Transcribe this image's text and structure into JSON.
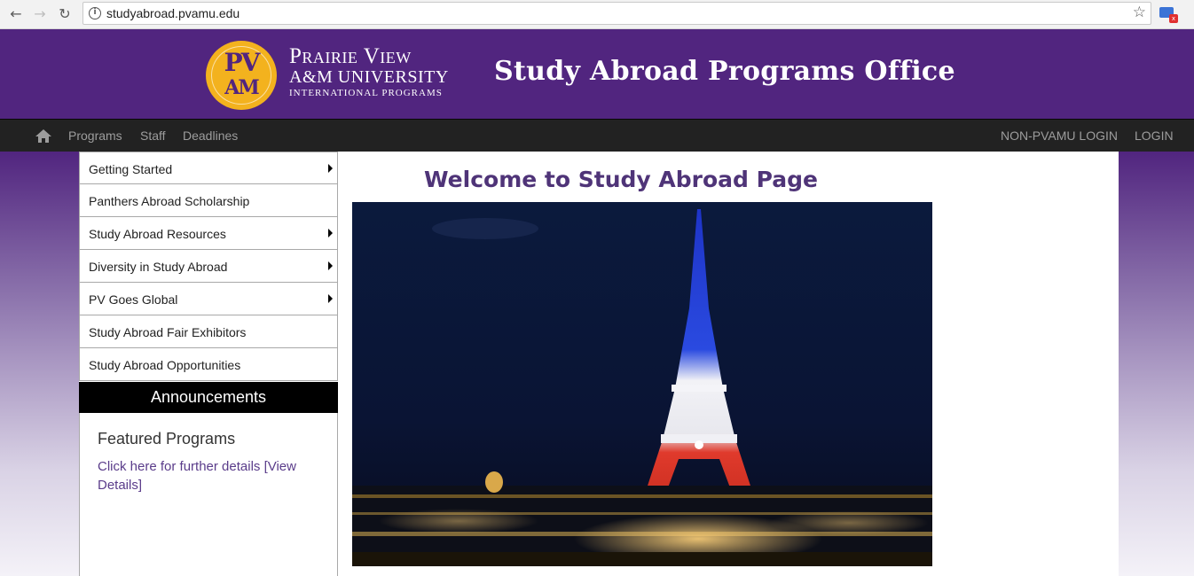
{
  "browser": {
    "url": "studyabroad.pvamu.edu",
    "back_icon": "arrow-left-icon",
    "forward_icon": "arrow-right-icon",
    "reload_icon": "reload-icon",
    "bookmark_icon": "star-icon",
    "extension_icon": "screen-extension-icon"
  },
  "header": {
    "logo_seal_top": "PV",
    "logo_seal_bottom": "AM",
    "logo_line1": "Prairie View",
    "logo_line2": "A&M UNIVERSITY",
    "logo_line3": "INTERNATIONAL PROGRAMS",
    "title": "Study Abroad Programs Office",
    "background": "#51257f"
  },
  "nav": {
    "home_icon": "home-icon",
    "links": [
      "Programs",
      "Staff",
      "Deadlines"
    ],
    "right_links": [
      "NON-PVAMU LOGIN",
      "LOGIN"
    ]
  },
  "sidebar": {
    "items": [
      {
        "label": "Getting Started",
        "has_submenu": true
      },
      {
        "label": "Panthers Abroad Scholarship",
        "has_submenu": false
      },
      {
        "label": "Study Abroad Resources",
        "has_submenu": true
      },
      {
        "label": "Diversity in Study Abroad",
        "has_submenu": true
      },
      {
        "label": "PV Goes Global",
        "has_submenu": true
      },
      {
        "label": "Study Abroad Fair Exhibitors",
        "has_submenu": false
      },
      {
        "label": "Study Abroad Opportunities",
        "has_submenu": false
      }
    ]
  },
  "announcements": {
    "heading": "Announcements",
    "featured_title": "Featured Programs",
    "featured_link": "Click here for further details [View Details]"
  },
  "main": {
    "welcome": "Welcome to Study Abroad Page",
    "hero_image": "eiffel-tower-night-photo"
  }
}
